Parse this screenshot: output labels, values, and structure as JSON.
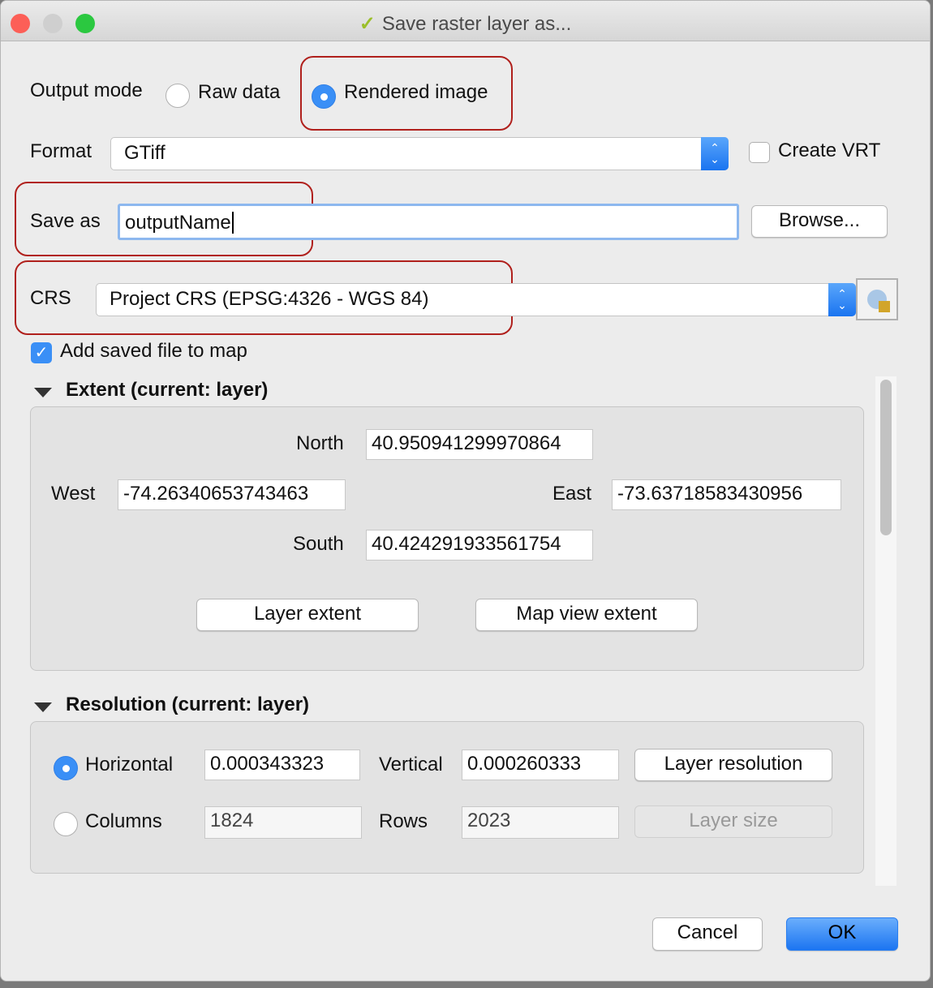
{
  "window": {
    "title": "Save raster layer as..."
  },
  "output_mode": {
    "label": "Output mode",
    "options": [
      {
        "label": "Raw data",
        "selected": false
      },
      {
        "label": "Rendered image",
        "selected": true
      }
    ]
  },
  "format": {
    "label": "Format",
    "value": "GTiff",
    "create_vrt_label": "Create VRT",
    "create_vrt_checked": false
  },
  "save_as": {
    "label": "Save as",
    "value": "outputName",
    "browse_label": "Browse..."
  },
  "crs": {
    "label": "CRS",
    "value": "Project CRS (EPSG:4326 - WGS 84)",
    "selector_icon": "crs-globe-icon"
  },
  "add_to_map": {
    "label": "Add saved file to map",
    "checked": true
  },
  "extent": {
    "title": "Extent (current: layer)",
    "north_label": "North",
    "north": "40.950941299970864",
    "west_label": "West",
    "west": "-74.26340653743463",
    "east_label": "East",
    "east": "-73.63718583430956",
    "south_label": "South",
    "south": "40.424291933561754",
    "layer_extent_label": "Layer extent",
    "map_view_extent_label": "Map view extent"
  },
  "resolution": {
    "title": "Resolution (current: layer)",
    "horizontal_label": "Horizontal",
    "horizontal": "0.000343323",
    "vertical_label": "Vertical",
    "vertical": "0.000260333",
    "layer_resolution_label": "Layer resolution",
    "columns_label": "Columns",
    "columns": "1824",
    "rows_label": "Rows",
    "rows": "2023",
    "layer_size_label": "Layer size",
    "mode": "Horizontal"
  },
  "footer": {
    "cancel_label": "Cancel",
    "ok_label": "OK"
  },
  "colors": {
    "accent": "#3a8ff6",
    "highlight": "#b0201c"
  }
}
